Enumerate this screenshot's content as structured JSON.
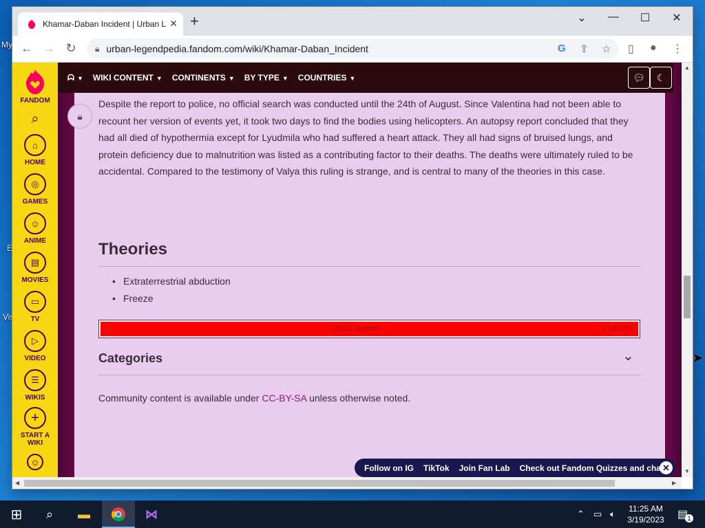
{
  "desktop": {
    "labels": [
      "My",
      "E",
      "Vis"
    ]
  },
  "browser": {
    "tab_title": "Khamar-Daban Incident | Urban L",
    "url": "urban-legendpedia.fandom.com/wiki/Khamar-Daban_Incident",
    "new_tab": "+",
    "controls": {
      "dropdown": "⌄",
      "minimize": "—",
      "maximize": "☐",
      "close": "✕"
    }
  },
  "fandom_rail": {
    "logo_label": "FANDOM",
    "items": [
      {
        "label": "HOME",
        "icon": "home-icon",
        "glyph": "⌂"
      },
      {
        "label": "GAMES",
        "icon": "games-icon",
        "glyph": "◎"
      },
      {
        "label": "ANIME",
        "icon": "anime-icon",
        "glyph": "☺"
      },
      {
        "label": "MOVIES",
        "icon": "movies-icon",
        "glyph": "▤"
      },
      {
        "label": "TV",
        "icon": "tv-icon",
        "glyph": "▭"
      },
      {
        "label": "VIDEO",
        "icon": "video-icon",
        "glyph": "▷"
      },
      {
        "label": "WIKIS",
        "icon": "wikis-icon",
        "glyph": "☰"
      }
    ],
    "start_wiki_label": "START A WIKI"
  },
  "global_nav": {
    "items": [
      "WIKI CONTENT",
      "CONTINENTS",
      "BY TYPE",
      "COUNTRIES"
    ]
  },
  "article": {
    "paragraph": "Despite the report to police, no official search was conducted until the 24th of August. Since Valentina had not been able to recount her version of events yet, it took two days to find the bodies using helicopters. An autopsy report concluded that they had all died of hypothermia except for Lyudmila who had suffered a heart attack. They all had signs of bruised lungs, and protein deficiency due to malnutrition was listed as a contributing factor to their deaths. The deaths were ultimately ruled to be accidental. Compared to the testimony of Valya this ruling is strange, and is central to many of the theories in this case.",
    "theories_heading": "Theories",
    "theories": [
      "Extraterrestrial abduction",
      "Freeze"
    ],
    "navbox_title": "Urban Legend",
    "navbox_right": "[Collapse]",
    "categories_label": "Categories",
    "license_prefix": "Community content is available under ",
    "license_link": "CC-BY-SA",
    "license_suffix": " unless otherwise noted."
  },
  "social_bar": {
    "items": [
      "Follow on IG",
      "TikTok",
      "Join Fan Lab",
      "Check out Fandom Quizzes and cha"
    ]
  },
  "taskbar": {
    "time": "11:25 AM",
    "date": "3/19/2023",
    "notification_count": "1"
  }
}
